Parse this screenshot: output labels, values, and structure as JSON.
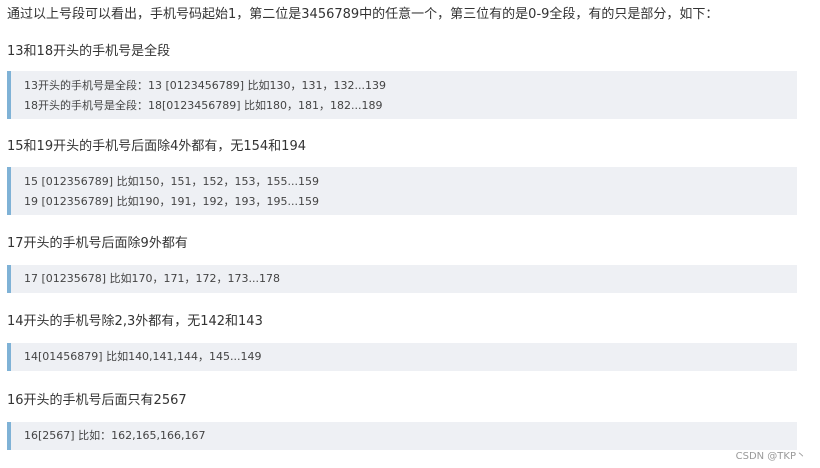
{
  "intro": "通过以上号段可以看出，手机号码起始1，第二位是3456789中的任意一个，第三位有的是0-9全段，有的只是部分，如下：",
  "sections": [
    {
      "heading": "13和18开头的手机号是全段",
      "lines": [
        "13开头的手机号是全段：13 [0123456789] 比如130，131，132...139",
        "18开头的手机号是全段：18[0123456789] 比如180，181，182...189"
      ]
    },
    {
      "heading": "15和19开头的手机号后面除4外都有，无154和194",
      "lines": [
        "15 [012356789] 比如150，151，152，153，155...159",
        "19 [012356789] 比如190，191，192，193，195...159"
      ]
    },
    {
      "heading": "17开头的手机号后面除9外都有",
      "lines": [
        "17 [01235678] 比如170，171，172，173...178"
      ]
    },
    {
      "heading": "14开头的手机号除2,3外都有，无142和143",
      "lines": [
        "14[01456879] 比如140,141,144，145...149"
      ]
    },
    {
      "heading": "16开头的手机号后面只有2567",
      "lines": [
        "16[2567] 比如：162,165,166,167"
      ]
    }
  ],
  "watermark": "CSDN @TKP丶"
}
